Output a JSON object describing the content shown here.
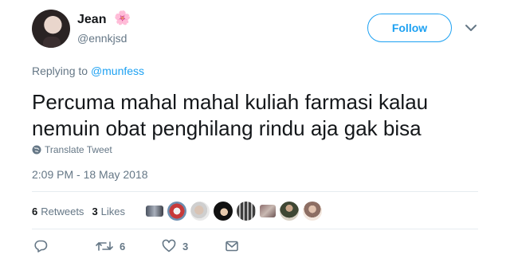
{
  "user": {
    "name": "Jean",
    "name_emoji": "🌸",
    "handle": "@ennkjsd"
  },
  "follow_label": "Follow",
  "reply": {
    "prefix": "Replying to",
    "mention": "@munfess"
  },
  "tweet": {
    "text_line1": "Percuma mahal mahal kuliah farmasi kalau",
    "text_line2": "nemuin obat penghilang rindu aja gak bisa",
    "translate_label": "Translate Tweet",
    "timestamp": "2:09 PM - 18 May 2018"
  },
  "stats": {
    "retweets_count": "6",
    "retweets_label": "Retweets",
    "likes_count": "3",
    "likes_label": "Likes"
  },
  "actions": {
    "reply_icon": "comment-icon",
    "retweet_count": "6",
    "like_count": "3",
    "message_icon": "envelope-icon"
  },
  "colors": {
    "accent": "#1da1f2",
    "muted_text": "#657786",
    "primary_text": "#14171a",
    "divider": "#e6ecf0"
  }
}
